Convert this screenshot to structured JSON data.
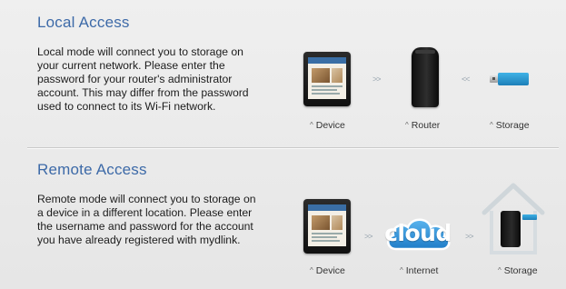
{
  "local_access": {
    "title": "Local Access",
    "description": [
      "Local mode will connect you to storage on",
      "your current network. Please enter the",
      "password for your router's administrator",
      "account. This may differ from the password",
      "used to connect to its Wi-Fi network."
    ],
    "diagram": {
      "items": [
        {
          "label": "Device",
          "icon": "tablet-icon"
        },
        {
          "label": "Router",
          "icon": "router-icon"
        },
        {
          "label": "Storage",
          "icon": "usb-storage-icon"
        }
      ],
      "arrows": [
        ">>",
        "<<"
      ]
    }
  },
  "remote_access": {
    "title": "Remote Access",
    "description": [
      "Remote mode will connect you to storage on",
      "a device in a different location. Please enter",
      "the username and password for the account",
      "you have already registered with mydlink."
    ],
    "diagram": {
      "items": [
        {
          "label": "Device",
          "icon": "tablet-icon"
        },
        {
          "label": "Internet",
          "icon": "cloud-icon"
        },
        {
          "label": "Storage",
          "icon": "house-storage-icon"
        }
      ],
      "arrows": [
        ">>",
        ">>"
      ],
      "cloud_text": "cloud"
    }
  },
  "label_caret": "^",
  "colors": {
    "title": "#3d6aa8",
    "cloud": "#2f8fd6",
    "usb": "#1d7fb8"
  }
}
